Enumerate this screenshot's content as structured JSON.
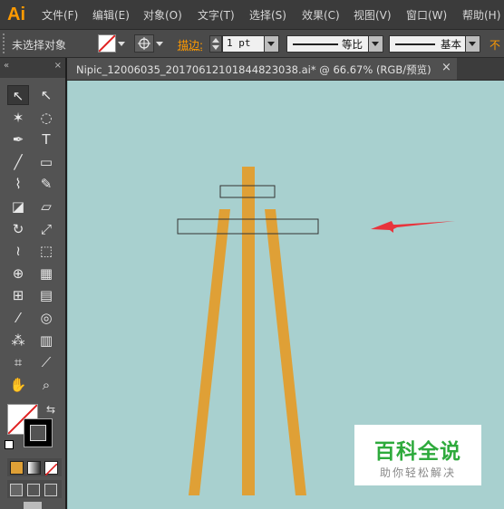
{
  "app": {
    "logo": "Ai",
    "accent": "#ff9a00"
  },
  "menubar": {
    "items": [
      "文件(F)",
      "编辑(E)",
      "对象(O)",
      "文字(T)",
      "选择(S)",
      "效果(C)",
      "视图(V)",
      "窗口(W)",
      "帮助(H)"
    ]
  },
  "control_bar": {
    "selection_status": "未选择对象",
    "stroke_label": "描边:",
    "stroke_weight": "1 pt",
    "profile_label": "等比",
    "brush_label": "基本",
    "opacity_label_partial": "不"
  },
  "document": {
    "tab_title": "Nipic_12006035_20170612101844823038.ai* @ 66.67% (RGB/预览)",
    "close_symbol": "×",
    "canvas_color": "#a8d0cf",
    "artwork_color": "#dfa036",
    "annotation_arrow_color": "#e8343c"
  },
  "tools": [
    {
      "name": "selection-tool",
      "glyph": "↖"
    },
    {
      "name": "direct-selection-tool",
      "glyph": "↖"
    },
    {
      "name": "magic-wand-tool",
      "glyph": "✶"
    },
    {
      "name": "lasso-tool",
      "glyph": "◌"
    },
    {
      "name": "pen-tool",
      "glyph": "✒"
    },
    {
      "name": "type-tool",
      "glyph": "T"
    },
    {
      "name": "line-tool",
      "glyph": "╱"
    },
    {
      "name": "rectangle-tool",
      "glyph": "▭"
    },
    {
      "name": "paintbrush-tool",
      "glyph": "⌇"
    },
    {
      "name": "pencil-tool",
      "glyph": "✎"
    },
    {
      "name": "blob-brush-tool",
      "glyph": "◪"
    },
    {
      "name": "eraser-tool",
      "glyph": "▱"
    },
    {
      "name": "rotate-tool",
      "glyph": "↻"
    },
    {
      "name": "scale-tool",
      "glyph": "⤢"
    },
    {
      "name": "warp-tool",
      "glyph": "≀"
    },
    {
      "name": "free-transform-tool",
      "glyph": "⬚"
    },
    {
      "name": "shape-builder-tool",
      "glyph": "⊕"
    },
    {
      "name": "perspective-grid-tool",
      "glyph": "▦"
    },
    {
      "name": "mesh-tool",
      "glyph": "⊞"
    },
    {
      "name": "gradient-tool",
      "glyph": "▤"
    },
    {
      "name": "eyedropper-tool",
      "glyph": "⁄"
    },
    {
      "name": "blend-tool",
      "glyph": "◎"
    },
    {
      "name": "symbol-sprayer-tool",
      "glyph": "⁂"
    },
    {
      "name": "column-graph-tool",
      "glyph": "▥"
    },
    {
      "name": "artboard-tool",
      "glyph": "⌗"
    },
    {
      "name": "slice-tool",
      "glyph": "⟋"
    },
    {
      "name": "hand-tool",
      "glyph": "✋"
    },
    {
      "name": "zoom-tool",
      "glyph": "⌕"
    }
  ],
  "watermark": {
    "title": "百科全说",
    "subtitle": "助你轻松解决",
    "title_color": "#2eaa3c"
  }
}
